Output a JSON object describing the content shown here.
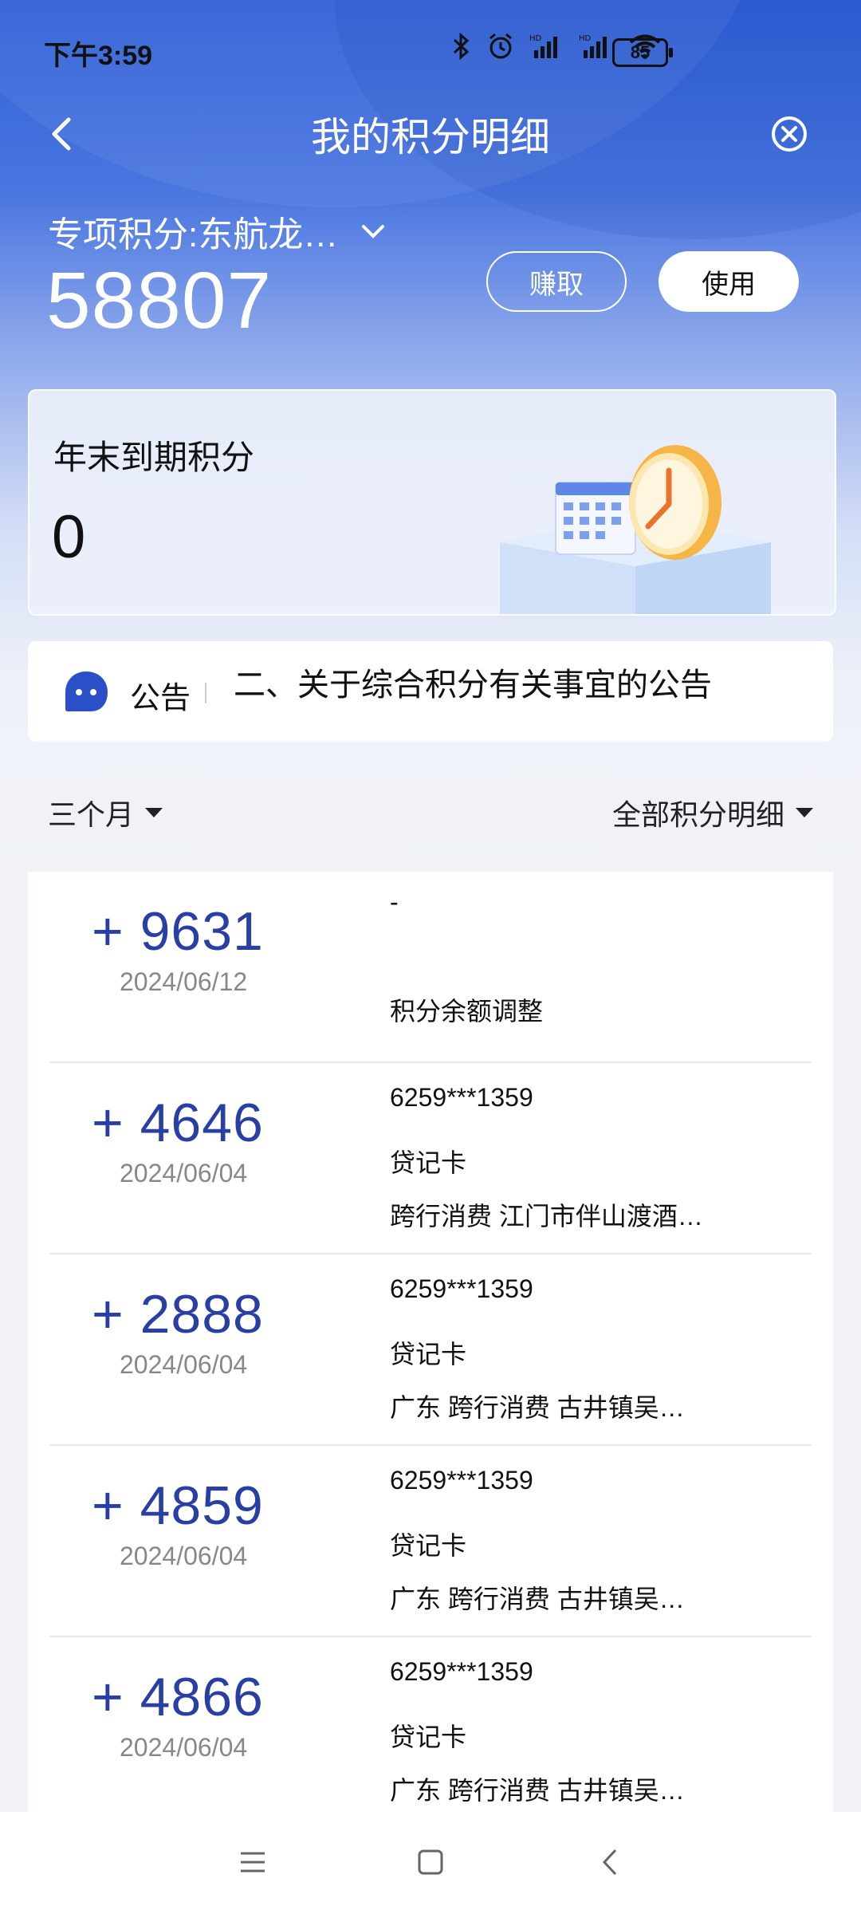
{
  "status": {
    "time": "下午3:59",
    "battery": "85"
  },
  "nav": {
    "title": "我的积分明细"
  },
  "account": {
    "name": "专项积分:东航龙…",
    "points": "58807",
    "earn_label": "赚取",
    "use_label": "使用"
  },
  "expire": {
    "label": "年末到期积分",
    "value": "0"
  },
  "notice": {
    "tag": "公告",
    "text": "二、关于综合积分有关事宜的公告"
  },
  "filters": {
    "period": "三个月",
    "type": "全部积分明细"
  },
  "records": [
    {
      "amount": "+ 9631",
      "date": "2024/06/12",
      "line1": "-",
      "line2": "",
      "line3": "积分余额调整"
    },
    {
      "amount": "+ 4646",
      "date": "2024/06/04",
      "line1": "6259***1359",
      "line2": "贷记卡",
      "line3": "跨行消费 江门市伴山渡酒…"
    },
    {
      "amount": "+ 2888",
      "date": "2024/06/04",
      "line1": "6259***1359",
      "line2": "贷记卡",
      "line3": "广东 跨行消费 古井镇吴…"
    },
    {
      "amount": "+ 4859",
      "date": "2024/06/04",
      "line1": "6259***1359",
      "line2": "贷记卡",
      "line3": "广东 跨行消费 古井镇吴…"
    },
    {
      "amount": "+ 4866",
      "date": "2024/06/04",
      "line1": "6259***1359",
      "line2": "贷记卡",
      "line3": "广东 跨行消费 古井镇吴…"
    }
  ],
  "colors": {
    "accent": "#2a3fa3",
    "header": "#2f5fd6"
  },
  "icons": [
    "back-icon",
    "close-circle-icon",
    "chevron-down-icon",
    "notice-bot-icon",
    "menu-icon",
    "home-icon",
    "nav-back-icon"
  ]
}
